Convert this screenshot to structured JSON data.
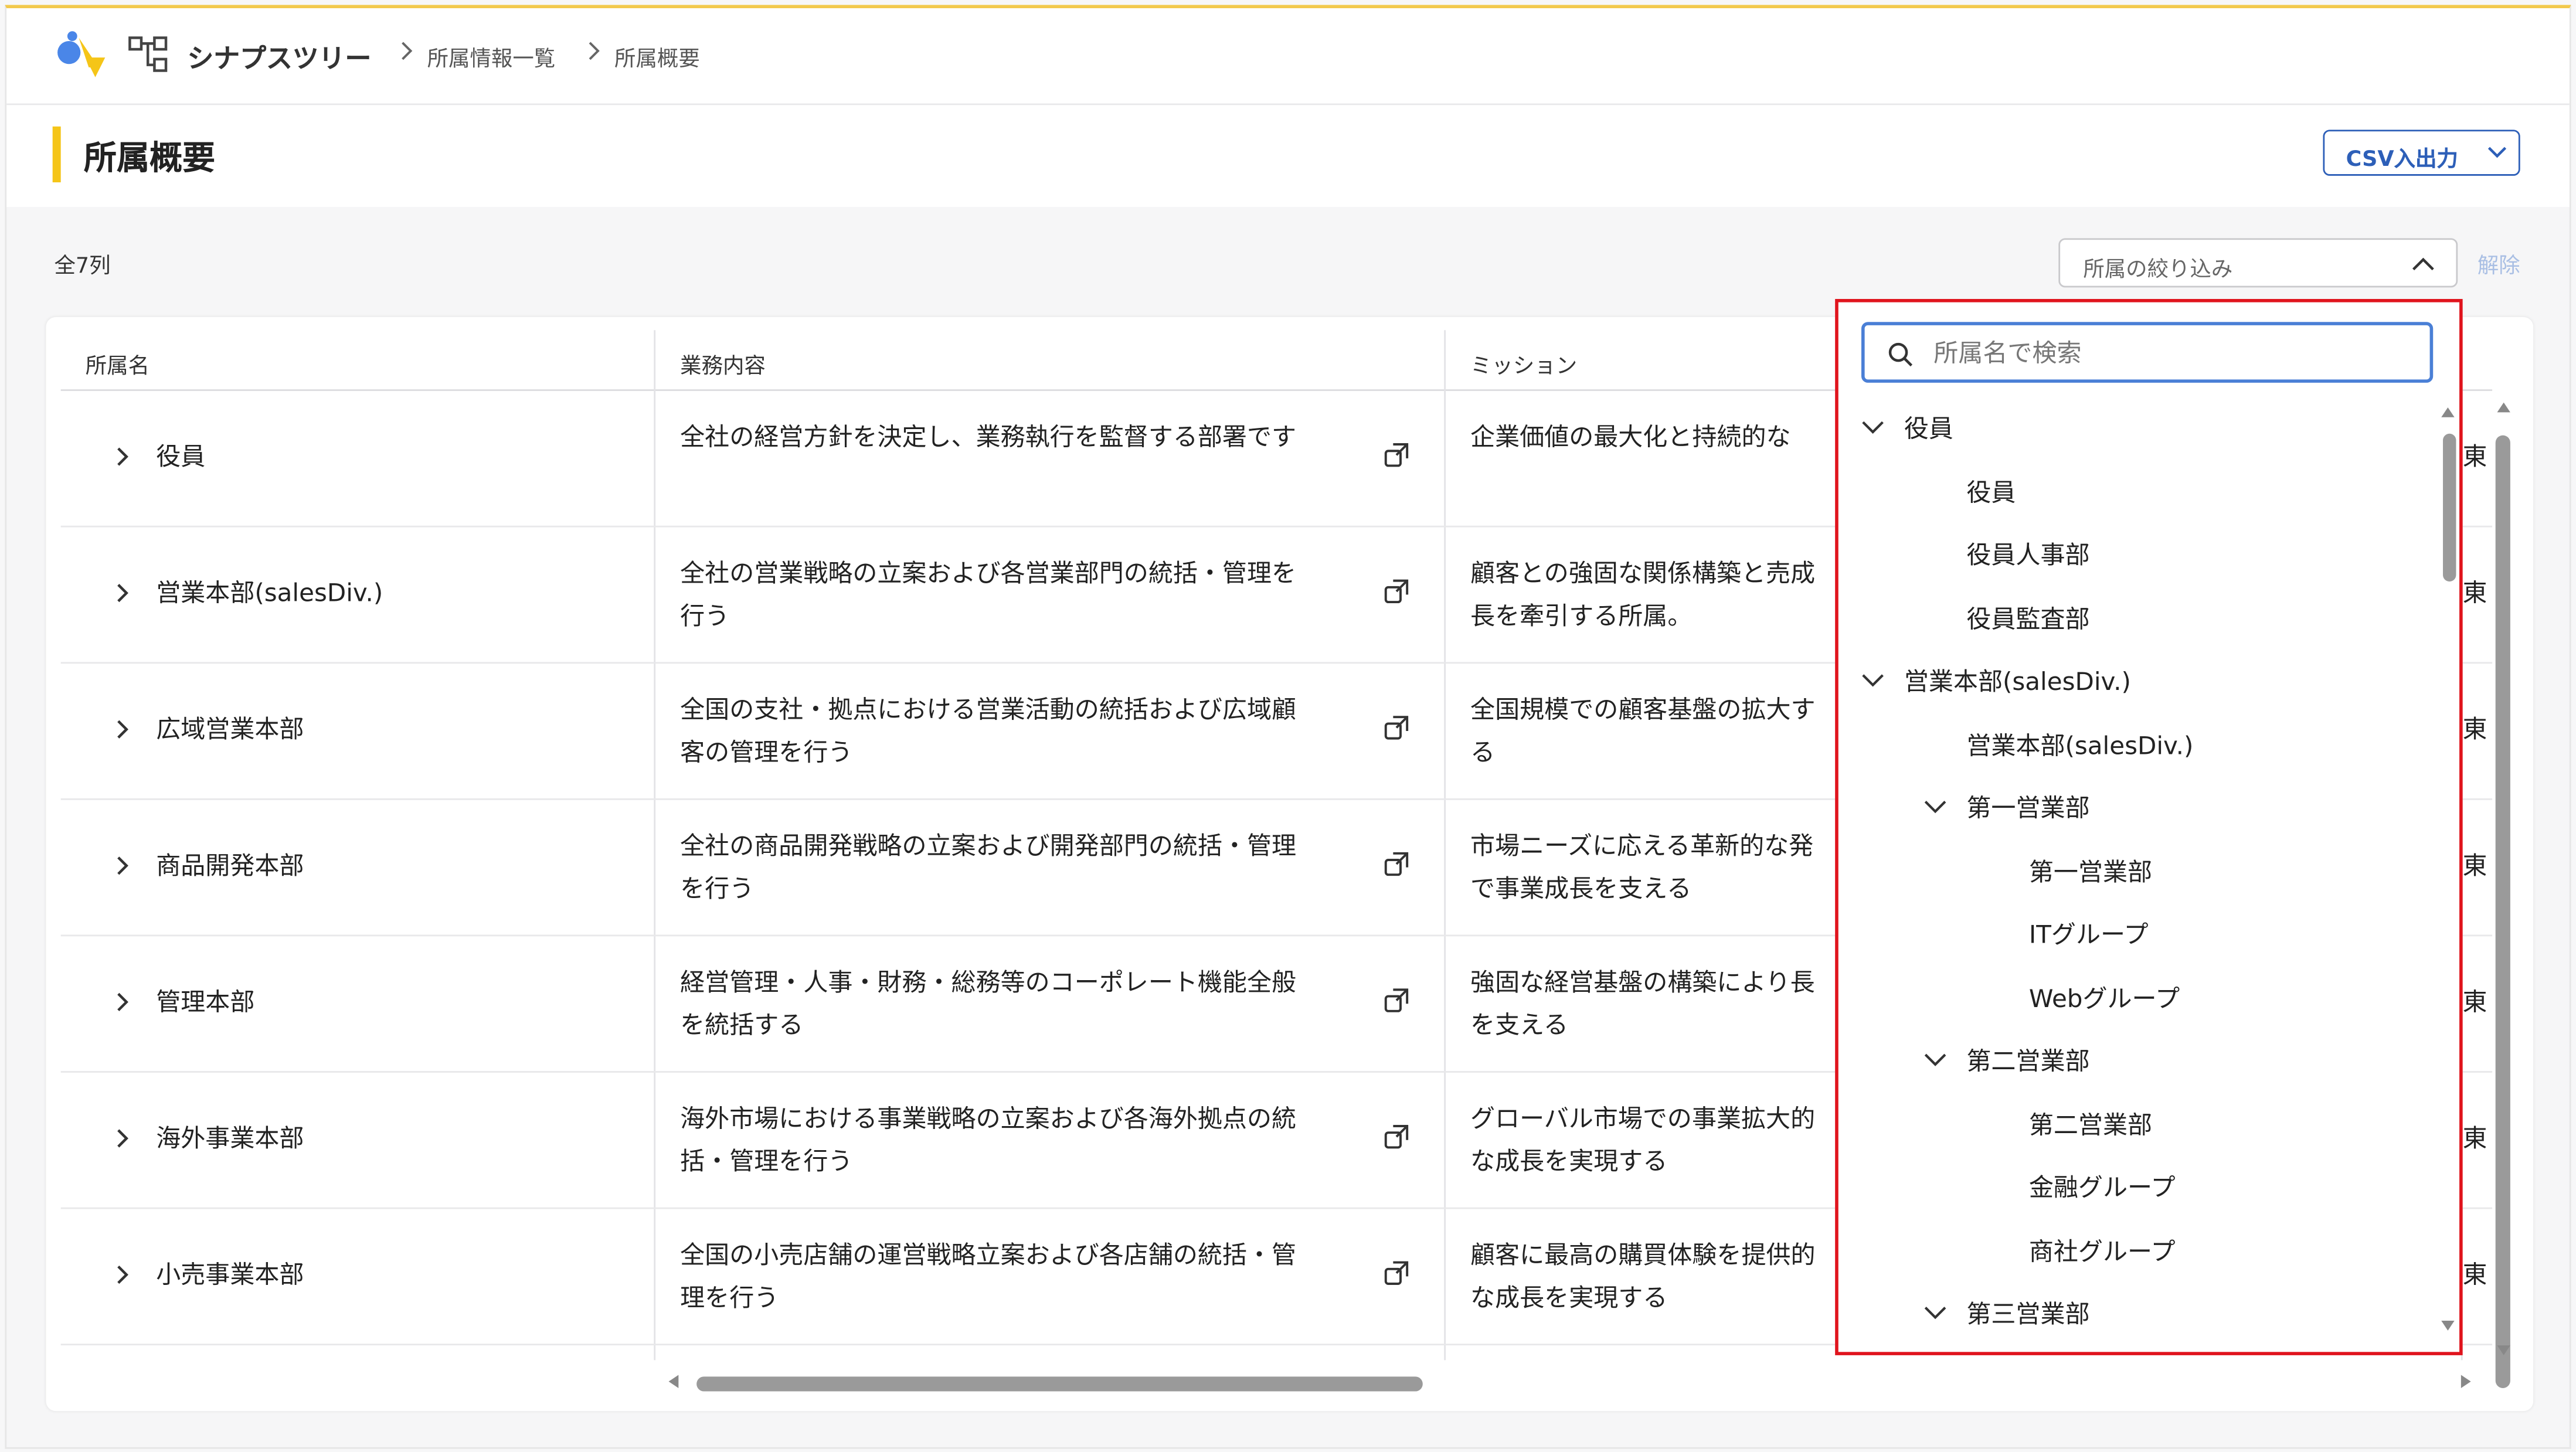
{
  "app": {
    "name": "シナプスツリー"
  },
  "breadcrumb": [
    "所属情報一覧",
    "所属概要"
  ],
  "page": {
    "title": "所属概要",
    "csv_button": "CSV入出力"
  },
  "summary": {
    "count_label": "全7列"
  },
  "filter": {
    "label": "所属の絞り込み",
    "clear_label": "解除"
  },
  "table": {
    "columns": [
      "所属名",
      "業務内容",
      "ミッション"
    ],
    "rows": [
      {
        "name": "役員",
        "desc": "全社の経営方針を決定し、業務執行を監督する部署です",
        "mission": "企業価値の最大化と持続的な",
        "cut": "東"
      },
      {
        "name": "営業本部(salesDiv.)",
        "desc": "全社の営業戦略の立案および各営業部門の統括・管理を行う",
        "mission": "顧客との強固な関係構築と売成長を牽引する所属。",
        "cut": "東"
      },
      {
        "name": "広域営業本部",
        "desc": "全国の支社・拠点における営業活動の統括および広域顧客の管理を行う",
        "mission": "全国規模での顧客基盤の拡大する",
        "cut": "東"
      },
      {
        "name": "商品開発本部",
        "desc": "全社の商品開発戦略の立案および開発部門の統括・管理を行う",
        "mission": "市場ニーズに応える革新的な発で事業成長を支える",
        "cut": "東"
      },
      {
        "name": "管理本部",
        "desc": "経営管理・人事・財務・総務等のコーポレート機能全般を統括する",
        "mission": "強固な経営基盤の構築により長を支える",
        "cut": "東"
      },
      {
        "name": "海外事業本部",
        "desc": "海外市場における事業戦略の立案および各海外拠点の統括・管理を行う",
        "mission": "グローバル市場での事業拡大的な成長を実現する",
        "cut": "東"
      },
      {
        "name": "小売事業本部",
        "desc": "全国の小売店舗の運営戦略立案および各店舗の統括・管理を行う",
        "mission": "顧客に最高の購買体験を提供的な成長を実現する",
        "cut": "東"
      }
    ]
  },
  "dropdown": {
    "search_placeholder": "所属名で検索",
    "items": [
      {
        "label": "役員",
        "level": 0,
        "expandable": true
      },
      {
        "label": "役員",
        "level": 1,
        "expandable": false
      },
      {
        "label": "役員人事部",
        "level": 1,
        "expandable": false
      },
      {
        "label": "役員監査部",
        "level": 1,
        "expandable": false
      },
      {
        "label": "営業本部(salesDiv.)",
        "level": 0,
        "expandable": true
      },
      {
        "label": "営業本部(salesDiv.)",
        "level": 1,
        "expandable": false
      },
      {
        "label": "第一営業部",
        "level": 1,
        "expandable": true
      },
      {
        "label": "第一営業部",
        "level": 2,
        "expandable": false
      },
      {
        "label": "ITグループ",
        "level": 2,
        "expandable": false
      },
      {
        "label": "Webグループ",
        "level": 2,
        "expandable": false
      },
      {
        "label": "第二営業部",
        "level": 1,
        "expandable": true
      },
      {
        "label": "第二営業部",
        "level": 2,
        "expandable": false
      },
      {
        "label": "金融グループ",
        "level": 2,
        "expandable": false
      },
      {
        "label": "商社グループ",
        "level": 2,
        "expandable": false
      },
      {
        "label": "第三営業部",
        "level": 1,
        "expandable": true
      }
    ]
  },
  "icons": {
    "logo": "app-logo-icon",
    "tree": "org-tree-icon",
    "row_chevron": "chevron-right-icon",
    "row_link": "external-link-icon",
    "search": "search-icon",
    "expand": "chevron-down-icon",
    "collapse": "chevron-up-icon"
  },
  "colors": {
    "accent_yellow": "#f5c518",
    "primary_blue": "#2d5fb8",
    "highlight_red": "#e0141d",
    "clear_link": "#a9bfe4"
  }
}
